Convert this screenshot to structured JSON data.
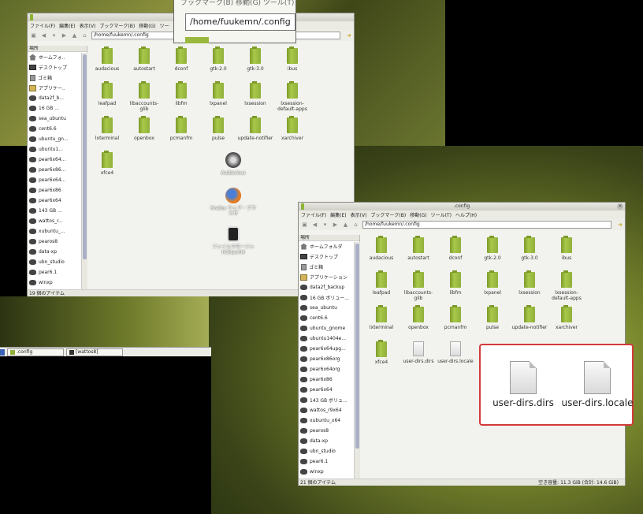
{
  "zoom": {
    "path": "/home/fuukemn/.config",
    "partial_menu": "ブックマーク(B)  移動(G)  ツール(T)"
  },
  "win1": {
    "menu": [
      "ファイル(F)",
      "編集(E)",
      "表示(V)",
      "ブックマーク(B)",
      "移動(G)",
      "ツー"
    ],
    "path": "/home/fuukemn/.config",
    "side_header": "場所",
    "sidebar": [
      "ホームフォ..",
      "デスクトップ",
      "ゴミ箱",
      "アプリケー..",
      "data2f_b...",
      "16 GB ...",
      "sea_ubuntu",
      "cent6.6",
      "ubuntu_gn...",
      "ubuntu1...",
      "pear6x64...",
      "pear6x86...",
      "pear6x64...",
      "pear6x86",
      "pear6x64",
      "143 GB ...",
      "wattos_r...",
      "xubuntu_...",
      "pearos8",
      "data-xp",
      "ubn_studio",
      "pear6.1",
      "winxp"
    ],
    "files": [
      "audacious",
      "autostart",
      "dconf",
      "gtk-2.0",
      "gtk-3.0",
      "ibus",
      "leafpad",
      "libaccounts-glib",
      "libfm",
      "lxpanel",
      "lxsession",
      "lxsession-default-apps",
      "lxterminal",
      "openbox",
      "pcmanfm",
      "pulse",
      "update-notifier",
      "xarchiver",
      "xfce4"
    ],
    "status": "19 個のアイテム"
  },
  "taskbar": {
    "items": [
      ".config",
      "[wattos8]"
    ]
  },
  "desktop_icons": [
    "Audacious",
    "Firefox ウェブ・ブラウザ",
    "ファイルマネージャ PCManFM"
  ],
  "win2": {
    "title": ".config",
    "menu": [
      "ファイル(F)",
      "編集(E)",
      "表示(V)",
      "ブックマーク(B)",
      "移動(G)",
      "ツール(T)",
      "ヘルプ(H)"
    ],
    "path": "/home/fuukemn/.config",
    "side_header": "場所",
    "sidebar": [
      "ホームフォルダ",
      "デスクトップ",
      "ゴミ箱",
      "アプリケーション",
      "data2f_backup",
      "16 GB ボリュー...",
      "sea_ubuntu",
      "cent6.6",
      "ubuntu_gnome",
      "ubuntu1404e...",
      "pear6x64upg...",
      "pear6x86org",
      "pear6x64org",
      "pear6x86",
      "pear6x64",
      "143 GB ボリュ...",
      "wattos_r9x64",
      "xubuntu_x64",
      "pearos8",
      "data-xp",
      "ubn_studio",
      "pear6.1",
      "winxp"
    ],
    "files": [
      "audacious",
      "autostart",
      "dconf",
      "gtk-2.0",
      "gtk-3.0",
      "ibus",
      "leafpad",
      "libaccounts-glib",
      "libfm",
      "lxpanel",
      "lxsession",
      "lxsession-default-apps",
      "lxterminal",
      "openbox",
      "pcmanfm",
      "pulse",
      "update-notifier",
      "xarchiver",
      "xfce4",
      "user-dirs.dirs",
      "user-dirs.locale"
    ],
    "status_left": "21 個のアイテム",
    "status_right": "空き容量: 11.3 GiB (合計: 14.6 GiB)"
  },
  "callout": {
    "files": [
      "user-dirs.dirs",
      "user-dirs.locale"
    ]
  }
}
